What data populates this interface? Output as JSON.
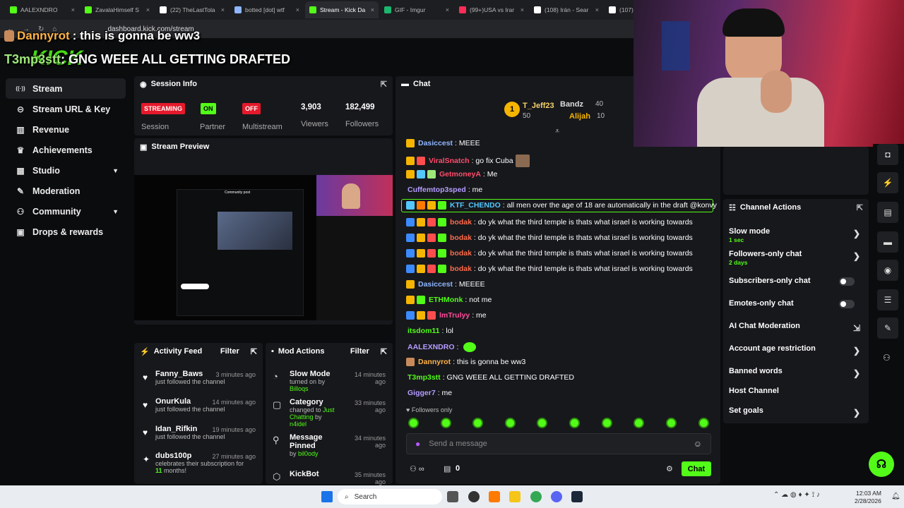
{
  "browser": {
    "tabs": [
      {
        "label": "AALEXNDRO",
        "color": "#53fc18"
      },
      {
        "label": "ZavalaHimself S",
        "color": "#53fc18"
      },
      {
        "label": "(22) TheLastTola",
        "color": "#ffffff"
      },
      {
        "label": "botted [dot] wtf",
        "color": "#8fb6ff"
      },
      {
        "label": "Stream - Kick Da",
        "color": "#53fc18"
      },
      {
        "label": "GIF - Imgur",
        "color": "#1bb76e"
      },
      {
        "label": "(99+)USA vs Irar",
        "color": "#ff2d55"
      },
      {
        "label": "(108) Irán - Sear",
        "color": "#ffffff"
      },
      {
        "label": "(107) D",
        "color": "#ffffff"
      }
    ],
    "url": "dashboard.kick.com/stream"
  },
  "overlay": {
    "user1": "Dannyrot",
    "msg1": ": this is gonna be ww3",
    "user2": "T3mp3stt",
    "msg2": ": GNG WEEE ALL GETTING DRAFTED",
    "logo": "KICK"
  },
  "sidebar": {
    "items": [
      {
        "label": "Stream",
        "icon": "stream-icon"
      },
      {
        "label": "Stream URL & Key",
        "icon": "link-icon"
      },
      {
        "label": "Revenue",
        "icon": "revenue-icon"
      },
      {
        "label": "Achievements",
        "icon": "trophy-icon"
      },
      {
        "label": "Studio",
        "icon": "studio-icon"
      },
      {
        "label": "Moderation",
        "icon": "wrench-icon"
      },
      {
        "label": "Community",
        "icon": "community-icon"
      },
      {
        "label": "Drops & rewards",
        "icon": "gift-icon"
      }
    ]
  },
  "session": {
    "title": "Session Info",
    "streaming": "STREAMING",
    "on": "ON",
    "off": "OFF",
    "session_label": "Session",
    "partner_label": "Partner",
    "multistream_label": "Multistream",
    "viewers": "3,903",
    "viewers_label": "Viewers",
    "followers": "182,499",
    "followers_label": "Followers"
  },
  "preview": {
    "title": "Stream Preview",
    "post_title": "Community post"
  },
  "activity": {
    "title": "Activity Feed",
    "filter": "Filter",
    "items": [
      {
        "name": "Fanny_Baws",
        "sub": "just followed the channel",
        "time": "3 minutes ago"
      },
      {
        "name": "OnurKula",
        "sub": "just followed the channel",
        "time": "14 minutes ago"
      },
      {
        "name": "Idan_Rifkin",
        "sub": "just followed the channel",
        "time": "19 minutes ago"
      },
      {
        "name": "dubs100p",
        "sub": "celebrates their subscription for",
        "time": "27 minutes ago",
        "extra": "11",
        "extra2": " months!"
      }
    ]
  },
  "modactions": {
    "title": "Mod Actions",
    "filter": "Filter",
    "items": [
      {
        "name": "Slow Mode",
        "sub": "turned on by ",
        "by": "Billoqs",
        "time": "14 minutes ago"
      },
      {
        "name": "Category",
        "sub": "changed to ",
        "by": "Just Chatting",
        "sub2": " by ",
        "by2": "n4idel",
        "time": "33 minutes ago"
      },
      {
        "name": "Message Pinned",
        "sub": "by ",
        "by": "bil0ody",
        "time": "34 minutes ago"
      },
      {
        "name": "KickBot",
        "time": "35 minutes ago"
      }
    ]
  },
  "chat": {
    "title": "Chat",
    "top": [
      {
        "name": "T_Jeff23",
        "count": "50"
      },
      {
        "name": "Bandz",
        "count": "40"
      },
      {
        "name": "Alijah",
        "count": "10"
      }
    ],
    "messages": [
      {
        "user": "Dasiccest",
        "color": "#8fb6ff",
        "text": ": MEEE"
      },
      {
        "user": "ViralSnatch",
        "color": "#ff4d6a",
        "text": ": go fix Cuba"
      },
      {
        "user": "GetmoneyA",
        "color": "#ff4d6a",
        "text": ": Me"
      },
      {
        "user": "Cuffemtop3sped",
        "color": "#b59cff",
        "text": ": me"
      },
      {
        "user": "KTF_CHENDO",
        "color": "#53c8ff",
        "text": ": all men over the age of 18 are automatically in the draft @konvy"
      },
      {
        "user": "bodak",
        "color": "#ff6b4a",
        "text": ": do yk what the third temple is thats what israel is working towards"
      },
      {
        "user": "bodak",
        "color": "#ff6b4a",
        "text": ": do yk what the third temple is thats what israel is working towards"
      },
      {
        "user": "bodak",
        "color": "#ff6b4a",
        "text": ": do yk what the third temple is thats what israel is working towards"
      },
      {
        "user": "bodak",
        "color": "#ff6b4a",
        "text": ": do yk what the third temple is thats what israel is working towards"
      },
      {
        "user": "Dasiccest",
        "color": "#8fb6ff",
        "text": ": MEEEE"
      },
      {
        "user": "ETHMonk",
        "color": "#53fc18",
        "text": ": not me"
      },
      {
        "user": "lmTrulyy",
        "color": "#ff4d9a",
        "text": ": me"
      },
      {
        "user": "itsdom11",
        "color": "#53fc18",
        "text": ": lol"
      },
      {
        "user": "AALEXNDRO",
        "color": "#b59cff",
        "text": ":"
      },
      {
        "user": "Dannyrot",
        "color": "#ffb347",
        "text": ": this is gonna be ww3"
      },
      {
        "user": "T3mp3stt",
        "color": "#53fc18",
        "text": ": GNG WEEE ALL GETTING DRAFTED"
      },
      {
        "user": "Gigger7",
        "color": "#b59cff",
        "text": ": me"
      }
    ],
    "followers_only": "Followers only",
    "placeholder": "Send a message",
    "points": "0",
    "send": "Chat"
  },
  "channel_actions": {
    "title": "Channel Actions",
    "slow_mode": "Slow mode",
    "slow_sub": "1 sec",
    "followers_only": "Followers-only chat",
    "followers_sub": "2 days",
    "subscribers_only": "Subscribers-only chat",
    "emotes_only": "Emotes-only chat",
    "ai_mod": "AI Chat Moderation",
    "account_age": "Account age restriction",
    "banned_words": "Banned words",
    "host_channel": "Host Channel",
    "set_goals": "Set goals"
  },
  "taskbar": {
    "search": "Search",
    "time": "12:03 AM",
    "date": "2/28/2026"
  },
  "colors": {
    "accent": "#53fc18",
    "panel": "#17181c",
    "bg": "#0b0c0e",
    "streaming_red": "#e5192b"
  }
}
